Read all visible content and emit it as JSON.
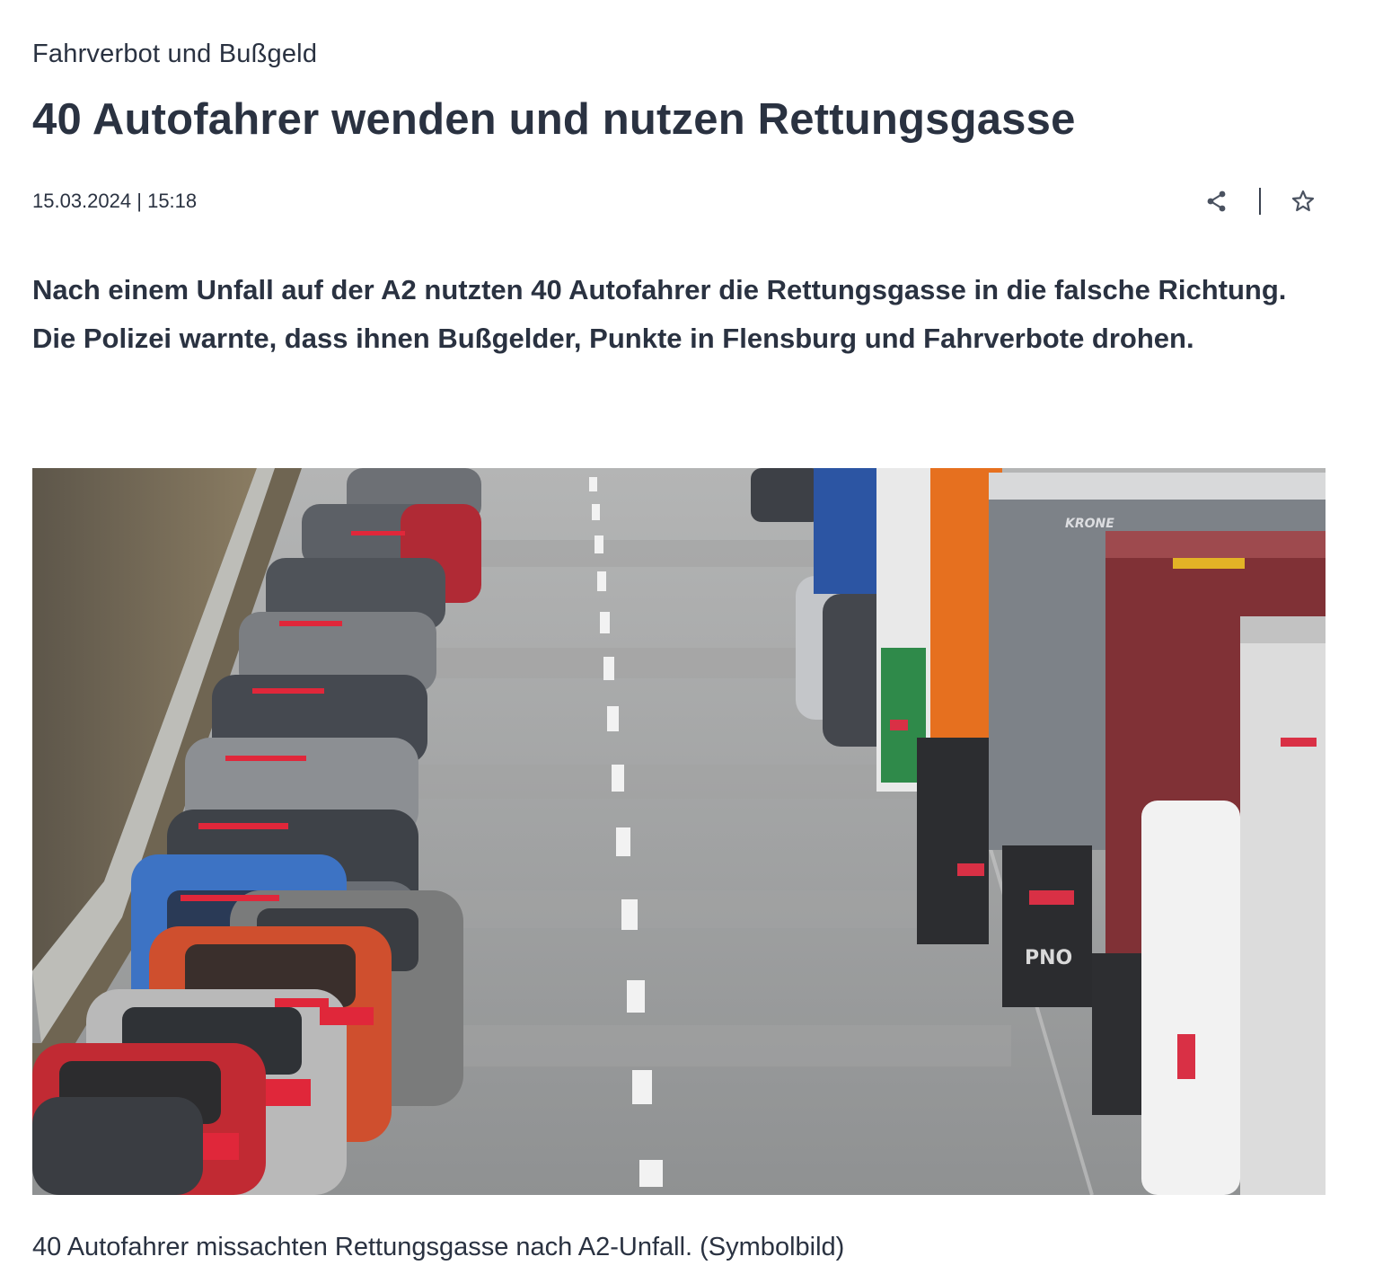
{
  "article": {
    "kicker": "Fahrverbot und Bußgeld",
    "headline": "40 Autofahrer wenden und nutzen Rettungsgasse",
    "date": "15.03.2024",
    "date_separator": "|",
    "time": "15:18",
    "lead": "Nach einem Unfall auf der A2 nutzten 40 Autofahrer die Rettungsgasse in die falsche Richtung. Die Polizei warnte, dass ihnen Bußgelder, Punkte in Flensburg und Fahrverbote drohen.",
    "image_caption": "40 Autofahrer missachten Rettungsgasse nach A2-Unfall. (Symbolbild)"
  },
  "actions": {
    "share_icon": "share-icon",
    "bookmark_icon": "star-icon"
  },
  "image_text": {
    "trailer_brand": "KRONE",
    "plate_fragment": "PNO"
  }
}
